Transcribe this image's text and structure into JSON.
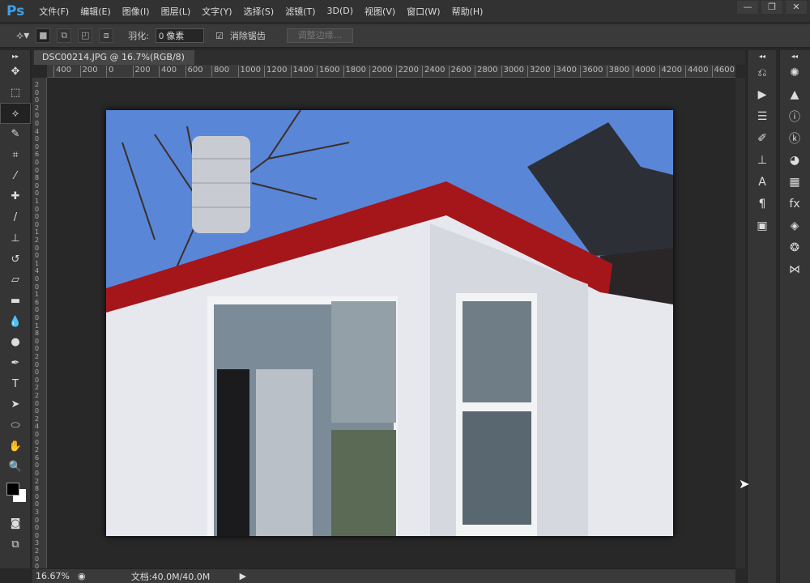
{
  "app": {
    "logo": "Ps",
    "menus": [
      "文件(F)",
      "编辑(E)",
      "图像(I)",
      "图层(L)",
      "文字(Y)",
      "选择(S)",
      "滤镜(T)",
      "3D(D)",
      "视图(V)",
      "窗口(W)",
      "帮助(H)"
    ],
    "window_controls": [
      "—",
      "❐",
      "✕"
    ]
  },
  "options": {
    "feather_label": "羽化:",
    "feather_value": "0 像素",
    "antialias_label": "消除锯齿",
    "antialias_checked": true,
    "refine_edge_label": "调整边缘..."
  },
  "document": {
    "tab_title": "DSC00214.JPG @ 16.7%(RGB/8)",
    "close": "×"
  },
  "ruler": {
    "horizontal": [
      "400",
      "200",
      "0",
      "200",
      "400",
      "600",
      "800",
      "1000",
      "1200",
      "1400",
      "1600",
      "1800",
      "2000",
      "2200",
      "2400",
      "2600",
      "2800",
      "3000",
      "3200",
      "3400",
      "3600",
      "3800",
      "4000",
      "4200",
      "4400",
      "4600"
    ],
    "vertical": [
      "2",
      "0",
      "0",
      "2",
      "0",
      "0",
      "4",
      "0",
      "0",
      "6",
      "0",
      "0",
      "8",
      "0",
      "0",
      "1",
      "0",
      "0",
      "0",
      "1",
      "2",
      "0",
      "0",
      "1",
      "4",
      "0",
      "0",
      "1",
      "6",
      "0",
      "0",
      "1",
      "8",
      "0",
      "0",
      "2",
      "0",
      "0",
      "0",
      "2",
      "2",
      "0",
      "0",
      "2",
      "4",
      "0",
      "0",
      "2",
      "6",
      "0",
      "0",
      "2",
      "8",
      "0",
      "0",
      "3",
      "0",
      "0",
      "0",
      "3",
      "2",
      "0",
      "0"
    ]
  },
  "status": {
    "zoom": "16.67%",
    "doc_size": "文档:40.0M/40.0M"
  },
  "colors": {
    "accent": "#3ea0e8",
    "sky": "#5a86d8",
    "roof": "#a4161a",
    "wall": "#e6e8ee"
  }
}
